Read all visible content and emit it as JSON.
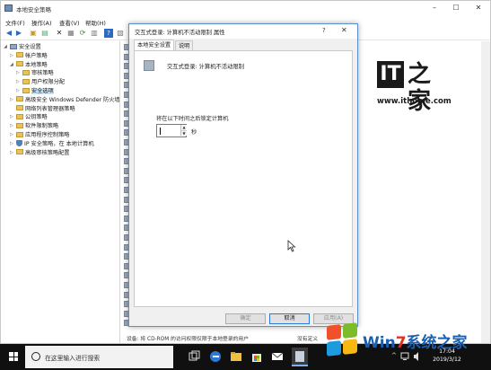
{
  "window": {
    "title": "本地安全策略"
  },
  "menu": [
    "文件(F)",
    "操作(A)",
    "查看(V)",
    "帮助(H)"
  ],
  "tree": [
    {
      "label": "安全设置",
      "depth": 0,
      "arrow": "◢",
      "kind": "root"
    },
    {
      "label": "帐户策略",
      "depth": 1,
      "arrow": "▷",
      "kind": "folder"
    },
    {
      "label": "本地策略",
      "depth": 1,
      "arrow": "◢",
      "kind": "folder"
    },
    {
      "label": "审核策略",
      "depth": 2,
      "arrow": "▷",
      "kind": "folder"
    },
    {
      "label": "用户权限分配",
      "depth": 2,
      "arrow": "▷",
      "kind": "folder"
    },
    {
      "label": "安全选项",
      "depth": 2,
      "arrow": "▷",
      "kind": "folder",
      "selected": true
    },
    {
      "label": "高级安全 Windows Defender 防火墙",
      "depth": 1,
      "arrow": "▷",
      "kind": "folder"
    },
    {
      "label": "网络列表管理器策略",
      "depth": 1,
      "arrow": "",
      "kind": "folder"
    },
    {
      "label": "公钥策略",
      "depth": 1,
      "arrow": "▷",
      "kind": "folder"
    },
    {
      "label": "软件限制策略",
      "depth": 1,
      "arrow": "▷",
      "kind": "folder"
    },
    {
      "label": "应用程序控制策略",
      "depth": 1,
      "arrow": "▷",
      "kind": "folder"
    },
    {
      "label": "IP 安全策略，在 本地计算机",
      "depth": 1,
      "arrow": "▷",
      "kind": "shield"
    },
    {
      "label": "高级审核策略配置",
      "depth": 1,
      "arrow": "▷",
      "kind": "folder"
    }
  ],
  "list_bottom": {
    "policy": "设备: 将 CD-ROM 的访问权限仅限于本地登录的用户",
    "setting": "没有定义"
  },
  "dialog": {
    "title": "交互式登录: 计算机不活动限制 属性",
    "help": "?",
    "close": "✕",
    "tabs": [
      "本地安全设置",
      "说明"
    ],
    "policy_name": "交互式登录: 计算机不活动限制",
    "field_label": "将在以下时间之后锁定计算机",
    "field_value": "",
    "unit": "秒",
    "buttons": {
      "ok": "确定",
      "cancel": "取消",
      "apply": "应用(A)"
    }
  },
  "watermark": {
    "logo_latin": "IT",
    "logo_cjk": "之家",
    "url": "www.ithome.com"
  },
  "taskbar": {
    "search_placeholder": "在这里输入进行搜索",
    "time": "17:04",
    "date": "2019/3/12",
    "tray_arrow": "^"
  },
  "win7mark": {
    "prefix": "Win",
    "digit": "7",
    "rest": "系统之家"
  }
}
